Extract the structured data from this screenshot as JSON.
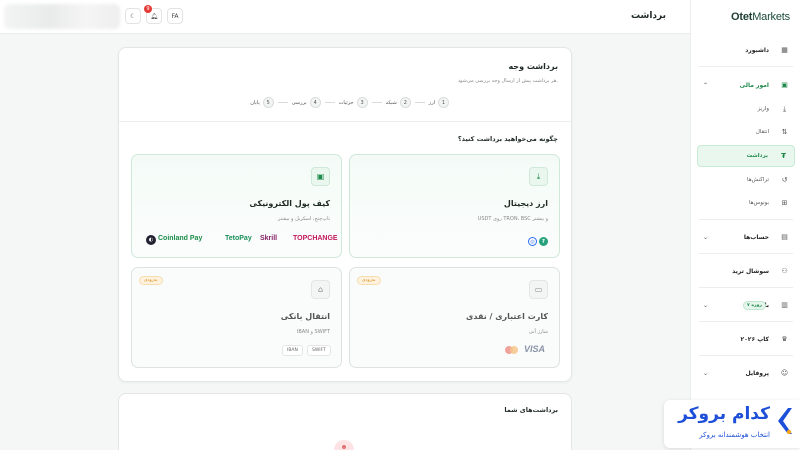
{
  "app": {
    "logo_prefix": "Otet",
    "logo_suffix": "Markets",
    "page_heading": "برداشت"
  },
  "topbar": {
    "lang_label": "FA",
    "notification_count": "9",
    "theme_icon": "moon-icon",
    "bell_icon": "bell-icon"
  },
  "sidebar": {
    "dashboard": "داشبورد",
    "financial": "امور مالی",
    "deposit": "واریز",
    "transfer": "انتقال",
    "withdraw": "برداشت",
    "transactions": "تراکنش‌ها",
    "bonuses": "بونوس‌ها",
    "accounts": "حساب‌ها",
    "social_trade": "سوشال ترید",
    "markets": "بازارها",
    "markets_badge": "۷ روزه",
    "cup": "کاپ ۲۰۲۶",
    "profile": "پروفایل"
  },
  "card": {
    "title": "برداشت وجه",
    "subtitle": "هر برداشت پیش از ارسال وجه بررسی می‌شود.",
    "steps": [
      {
        "num": "1",
        "label": "ارز"
      },
      {
        "num": "2",
        "label": "شبکه"
      },
      {
        "num": "3",
        "label": "جزئیات"
      },
      {
        "num": "4",
        "label": "بررسی"
      },
      {
        "num": "5",
        "label": "پایان"
      }
    ],
    "question": "چگونه می‌خواهید برداشت کنید؟",
    "options": {
      "crypto": {
        "title": "ارز دیجیتال",
        "desc": "USDT روی TRON، BSC و بیشتر",
        "icon": "download-icon",
        "coins": [
          "USDT-TRON",
          "USDT-BSC"
        ]
      },
      "ewallet": {
        "title": "کیف پول الکترونیکی",
        "desc": "تاپ‌چنج، اسکریل و بیشتر",
        "icon": "wallet-icon",
        "brands": [
          "Coinland Pay",
          "TetoPay",
          "Skrill",
          "TOPCHANGE"
        ]
      },
      "card": {
        "title": "کارت اعتباری / نقدی",
        "desc": "شارژ آنی",
        "icon": "credit-card-icon",
        "soon": "به‌زودی",
        "brands": [
          "VISA",
          "Mastercard"
        ]
      },
      "bank": {
        "title": "انتقال بانکی",
        "desc": "IBAN و SWIFT",
        "icon": "bank-icon",
        "soon": "به‌زودی",
        "chips": [
          "SWIFT",
          "IBAN"
        ]
      }
    }
  },
  "history": {
    "title": "برداشت‌های شما"
  },
  "watermark": {
    "title": "کدام بروکر",
    "subtitle": "انتخاب هوشمندانه بروکر"
  },
  "colors": {
    "accent": "#1f8a4c",
    "soon": "#d68a10",
    "watermark": "#1d4fd8"
  }
}
